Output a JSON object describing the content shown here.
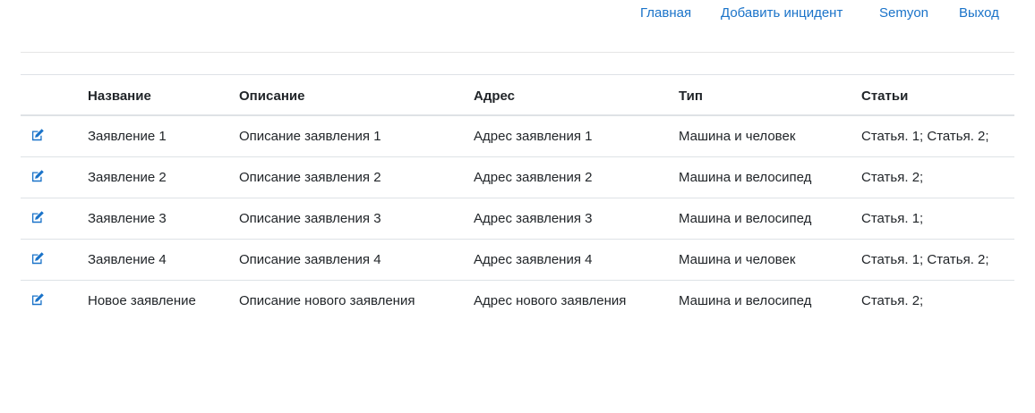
{
  "nav": {
    "home": "Главная",
    "add_incident": "Добавить инцидент",
    "user": "Semyon",
    "logout": "Выход"
  },
  "table": {
    "headers": {
      "name": "Название",
      "description": "Описание",
      "address": "Адрес",
      "type": "Тип",
      "articles": "Статьи"
    },
    "rows": [
      {
        "name": "Заявление 1",
        "description": "Описание заявления 1",
        "address": "Адрес заявления 1",
        "type": "Машина и человек",
        "articles": "Статья. 1; Статья. 2;"
      },
      {
        "name": "Заявление 2",
        "description": "Описание заявления 2",
        "address": "Адрес заявления 2",
        "type": "Машина и велосипед",
        "articles": "Статья. 2;"
      },
      {
        "name": "Заявление 3",
        "description": "Описание заявления 3",
        "address": "Адрес заявления 3",
        "type": "Машина и велосипед",
        "articles": "Статья. 1;"
      },
      {
        "name": "Заявление 4",
        "description": "Описание заявления 4",
        "address": "Адрес заявления 4",
        "type": "Машина и человек",
        "articles": "Статья. 1; Статья. 2;"
      },
      {
        "name": "Новое заявление",
        "description": "Описание нового заявления",
        "address": "Адрес нового заявления",
        "type": "Машина и велосипед",
        "articles": "Статья. 2;"
      }
    ]
  },
  "icons": {
    "edit": "edit-icon"
  },
  "colors": {
    "link": "#1a73c9",
    "text": "#212529",
    "border": "#dee2e6"
  }
}
